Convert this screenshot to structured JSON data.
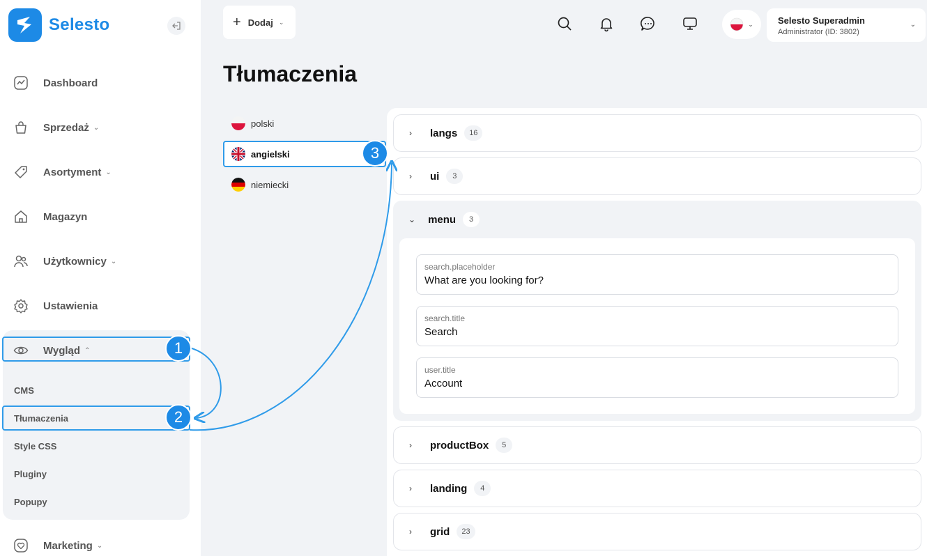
{
  "app": {
    "name": "Selesto"
  },
  "sidebar": {
    "items": [
      {
        "label": "Dashboard",
        "icon": "chart-icon"
      },
      {
        "label": "Sprzedaż",
        "icon": "bag-icon",
        "chevron": "⌄"
      },
      {
        "label": "Asortyment",
        "icon": "tag-icon",
        "chevron": "⌄"
      },
      {
        "label": "Magazyn",
        "icon": "home-icon"
      },
      {
        "label": "Użytkownicy",
        "icon": "users-icon",
        "chevron": "⌄"
      },
      {
        "label": "Ustawienia",
        "icon": "gear-icon"
      },
      {
        "label": "Wygląd",
        "icon": "eye-icon",
        "chevron": "⌃"
      },
      {
        "label": "Marketing",
        "icon": "heart-icon",
        "chevron": "⌄"
      }
    ],
    "submenu": [
      "CMS",
      "Tłumaczenia",
      "Style CSS",
      "Pluginy",
      "Popupy"
    ]
  },
  "topbar": {
    "add_label": "Dodaj",
    "user_name": "Selesto Superadmin",
    "user_role": "Administrator (ID: 3802)"
  },
  "page": {
    "title": "Tłumaczenia"
  },
  "languages": [
    {
      "label": "polski",
      "flag": "pl"
    },
    {
      "label": "angielski",
      "flag": "gb",
      "active": true
    },
    {
      "label": "niemiecki",
      "flag": "de"
    }
  ],
  "groups": {
    "langs": {
      "name": "langs",
      "count": "16"
    },
    "ui": {
      "name": "ui",
      "count": "3"
    },
    "menu": {
      "name": "menu",
      "count": "3",
      "fields": [
        {
          "key": "search.placeholder",
          "value": "What are you looking for?"
        },
        {
          "key": "search.title",
          "value": "Search"
        },
        {
          "key": "user.title",
          "value": "Account"
        }
      ]
    },
    "productBox": {
      "name": "productBox",
      "count": "5"
    },
    "landing": {
      "name": "landing",
      "count": "4"
    },
    "grid": {
      "name": "grid",
      "count": "23"
    }
  },
  "annotations": {
    "step1": "1",
    "step2": "2",
    "step3": "3"
  },
  "colors": {
    "accent": "#1d8ae6",
    "highlight": "#2f9be9"
  }
}
